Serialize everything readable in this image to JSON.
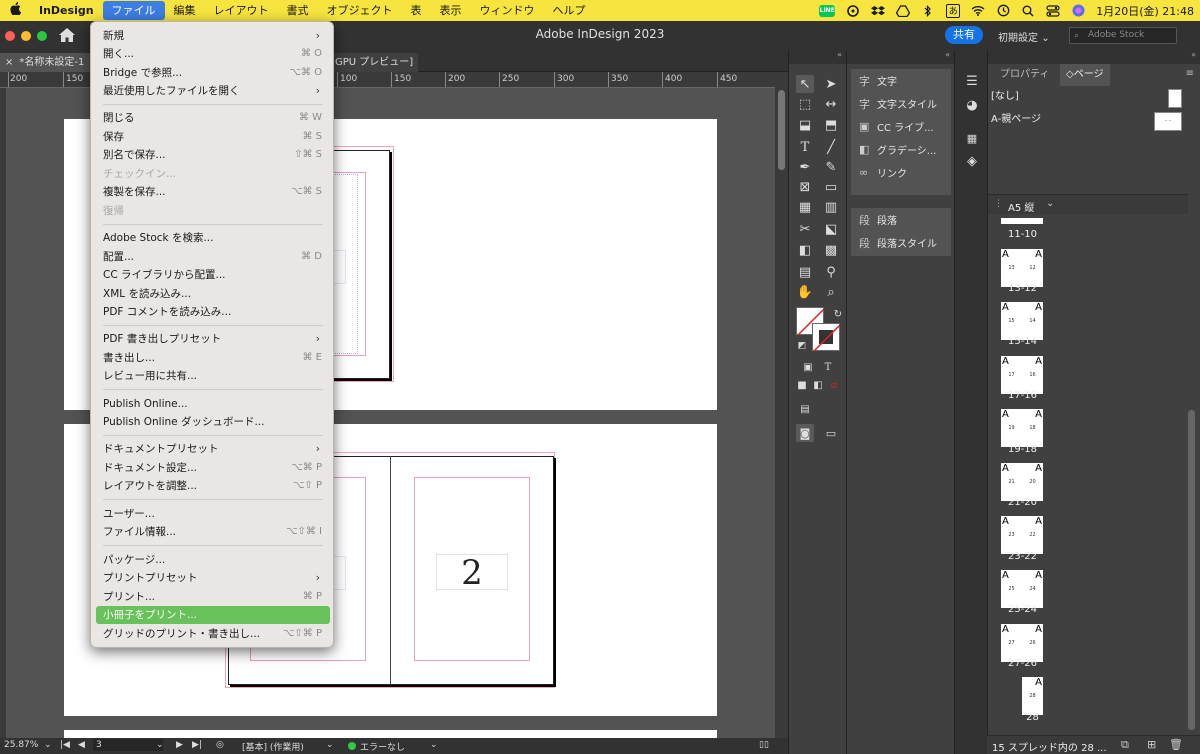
{
  "menubar": {
    "app_name": "InDesign",
    "menus": [
      "ファイル",
      "編集",
      "レイアウト",
      "書式",
      "オブジェクト",
      "表",
      "表示",
      "ウィンドウ",
      "ヘルプ"
    ],
    "clock": "1月20日(金) 21:48",
    "line_label": "LINE",
    "ime_label": "あ"
  },
  "app": {
    "title": "Adobe InDesign 2023",
    "share_label": "共有",
    "workspace": "初期設定",
    "stock_placeholder": "Adobe Stock",
    "traffic_colors": [
      "#fe5f57",
      "#febc2e",
      "#28c840"
    ]
  },
  "tabs": {
    "doc_tab": "*名称未設定-1 @",
    "gpu_tab": "GPU プレビュー]"
  },
  "ruler": {
    "labels": [
      "200",
      "150",
      "350",
      "400",
      "450"
    ],
    "labels2": [
      "100",
      "150",
      "200",
      "250",
      "300"
    ]
  },
  "canvas": {
    "page_number": "2"
  },
  "status": {
    "zoom": "25.87%",
    "page": "3",
    "style": "[基本] (作業用)",
    "errors": "エラーなし",
    "ok_color": "#2ecc40"
  },
  "panels": {
    "items": [
      {
        "icon": "字",
        "label": "文字"
      },
      {
        "icon": "字",
        "label": "文字スタイル"
      },
      {
        "icon": "▣",
        "label": "CC ライブ..."
      },
      {
        "icon": "◧",
        "label": "グラデーシ..."
      },
      {
        "icon": "∞",
        "label": "リンク"
      },
      {
        "icon": "段",
        "label": "段落"
      },
      {
        "icon": "段",
        "label": "段落スタイル"
      }
    ]
  },
  "pages_panel": {
    "tab_properties": "プロパティ",
    "tab_pages": "ページ",
    "none_master": "[なし]",
    "a_master": "A-親ページ",
    "page_size": "A5 縦",
    "spreads": [
      {
        "label": "11-10",
        "left": "",
        "right": ""
      },
      {
        "label": "13-12",
        "left": "13",
        "right": "12"
      },
      {
        "label": "15-14",
        "left": "15",
        "right": "14"
      },
      {
        "label": "17-16",
        "left": "17",
        "right": "16"
      },
      {
        "label": "19-18",
        "left": "19",
        "right": "18"
      },
      {
        "label": "21-20",
        "left": "21",
        "right": "20"
      },
      {
        "label": "23-22",
        "left": "23",
        "right": "22"
      },
      {
        "label": "25-24",
        "left": "25",
        "right": "24"
      },
      {
        "label": "27-26",
        "left": "27",
        "right": "26"
      },
      {
        "label": "28",
        "left": "",
        "right": "28"
      }
    ],
    "master_letter": "A",
    "footer": "15 スプレッド内の 28 ..."
  },
  "file_menu": {
    "items": [
      {
        "label": "新規",
        "shortcut": "",
        "submenu": true,
        "disabled": false
      },
      {
        "label": "開く...",
        "shortcut": "⌘ O",
        "submenu": false,
        "disabled": false
      },
      {
        "label": "Bridge で参照...",
        "shortcut": "⌥⌘ O",
        "submenu": false,
        "disabled": false
      },
      {
        "label": "最近使用したファイルを開く",
        "shortcut": "",
        "submenu": true,
        "disabled": false
      },
      {
        "label": "閉じる",
        "shortcut": "⌘ W",
        "submenu": false,
        "disabled": false
      },
      {
        "label": "保存",
        "shortcut": "⌘ S",
        "submenu": false,
        "disabled": false
      },
      {
        "label": "別名で保存...",
        "shortcut": "⇧⌘ S",
        "submenu": false,
        "disabled": false
      },
      {
        "label": "チェックイン...",
        "shortcut": "",
        "submenu": false,
        "disabled": true
      },
      {
        "label": "複製を保存...",
        "shortcut": "⌥⌘ S",
        "submenu": false,
        "disabled": false
      },
      {
        "label": "復帰",
        "shortcut": "",
        "submenu": false,
        "disabled": true
      },
      {
        "label": "Adobe Stock を検索...",
        "shortcut": "",
        "submenu": false,
        "disabled": false
      },
      {
        "label": "配置...",
        "shortcut": "⌘ D",
        "submenu": false,
        "disabled": false
      },
      {
        "label": "CC ライブラリから配置...",
        "shortcut": "",
        "submenu": false,
        "disabled": false
      },
      {
        "label": "XML を読み込み...",
        "shortcut": "",
        "submenu": false,
        "disabled": false
      },
      {
        "label": "PDF コメントを読み込み...",
        "shortcut": "",
        "submenu": false,
        "disabled": false
      },
      {
        "label": "PDF 書き出しプリセット",
        "shortcut": "",
        "submenu": true,
        "disabled": false
      },
      {
        "label": "書き出し...",
        "shortcut": "⌘ E",
        "submenu": false,
        "disabled": false
      },
      {
        "label": "レビュー用に共有...",
        "shortcut": "",
        "submenu": false,
        "disabled": false
      },
      {
        "label": "Publish Online...",
        "shortcut": "",
        "submenu": false,
        "disabled": false
      },
      {
        "label": "Publish Online ダッシュボード...",
        "shortcut": "",
        "submenu": false,
        "disabled": false
      },
      {
        "label": "ドキュメントプリセット",
        "shortcut": "",
        "submenu": true,
        "disabled": false
      },
      {
        "label": "ドキュメント設定...",
        "shortcut": "⌥⌘ P",
        "submenu": false,
        "disabled": false
      },
      {
        "label": "レイアウトを調整...",
        "shortcut": "⌥⇧ P",
        "submenu": false,
        "disabled": false
      },
      {
        "label": "ユーザー...",
        "shortcut": "",
        "submenu": false,
        "disabled": false
      },
      {
        "label": "ファイル情報...",
        "shortcut": "⌥⇧⌘ I",
        "submenu": false,
        "disabled": false
      },
      {
        "label": "パッケージ...",
        "shortcut": "",
        "submenu": false,
        "disabled": false
      },
      {
        "label": "プリントプリセット",
        "shortcut": "",
        "submenu": true,
        "disabled": false
      },
      {
        "label": "プリント...",
        "shortcut": "⌘ P",
        "submenu": false,
        "disabled": false
      },
      {
        "label": "小冊子をプリント...",
        "shortcut": "",
        "submenu": false,
        "disabled": false,
        "highlight": true
      },
      {
        "label": "グリッドのプリント・書き出し...",
        "shortcut": "⌥⇧⌘ P",
        "submenu": false,
        "disabled": false
      }
    ]
  }
}
